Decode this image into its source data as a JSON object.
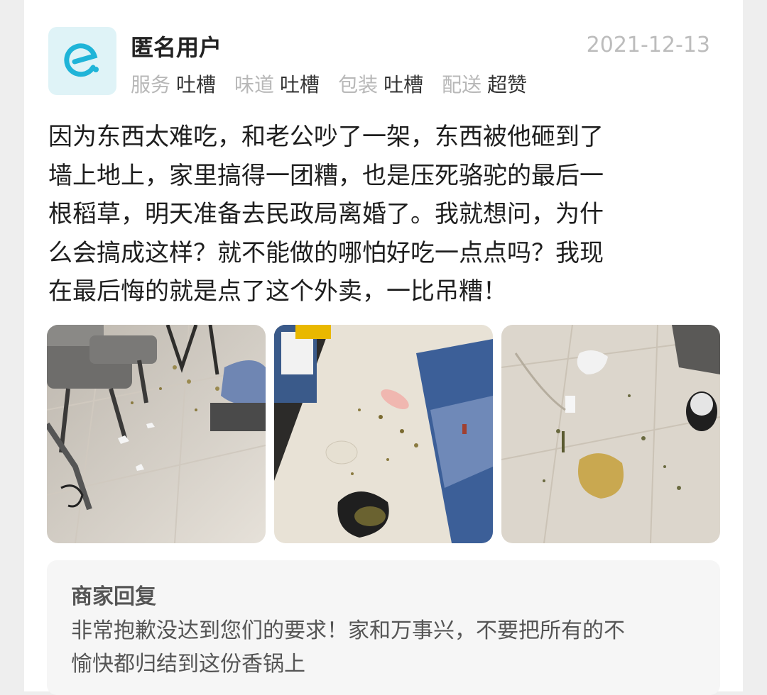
{
  "user": {
    "name": "匿名用户",
    "date": "2021-12-13",
    "avatar_icon": "eleme-logo-icon"
  },
  "ratings": [
    {
      "label": "服务",
      "value": "吐槽"
    },
    {
      "label": "味道",
      "value": "吐槽"
    },
    {
      "label": "包装",
      "value": "吐槽"
    },
    {
      "label": "配送",
      "value": "超赞"
    }
  ],
  "review": {
    "text": "因为东西太难吃，和老公吵了一架，东西被他砸到了\n墙上地上，家里搞得一团糟，也是压死骆驼的最后一\n根稻草，明天准备去民政局离婚了。我就想问，为什\n么会搞成这样？就不能做的哪怕好吃一点点吗？我现\n在最后悔的就是点了这个外卖，一比吊糟！"
  },
  "reply": {
    "title": "商家回复",
    "text": "非常抱歉没达到您们的要求！家和万事兴，不要把所有的不\n愉快都归结到这份香锅上"
  },
  "colors": {
    "accent": "#1fb4d8",
    "avatar_bg": "#dff3f7"
  }
}
